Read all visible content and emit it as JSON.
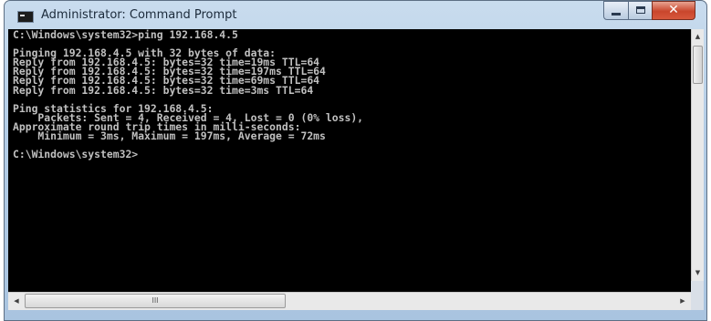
{
  "window": {
    "title": "Administrator: Command Prompt",
    "close_glyph": "✕",
    "icon": "cmd-icon"
  },
  "console": {
    "text": "C:\\Windows\\system32>ping 192.168.4.5\n\nPinging 192.168.4.5 with 32 bytes of data:\nReply from 192.168.4.5: bytes=32 time=19ms TTL=64\nReply from 192.168.4.5: bytes=32 time=197ms TTL=64\nReply from 192.168.4.5: bytes=32 time=69ms TTL=64\nReply from 192.168.4.5: bytes=32 time=3ms TTL=64\n\nPing statistics for 192.168.4.5:\n    Packets: Sent = 4, Received = 4, Lost = 0 (0% loss),\nApproximate round trip times in milli-seconds:\n    Minimum = 3ms, Maximum = 197ms, Average = 72ms\n\nC:\\Windows\\system32>"
  },
  "scrollbars": {
    "horizontal_grip": "III",
    "up_arrow": "▲",
    "down_arrow": "▼",
    "left_arrow": "◀",
    "right_arrow": "▶"
  },
  "colors": {
    "console_bg": "#000000",
    "console_text": "#c0c0c0",
    "close_button": "#c9462c"
  }
}
